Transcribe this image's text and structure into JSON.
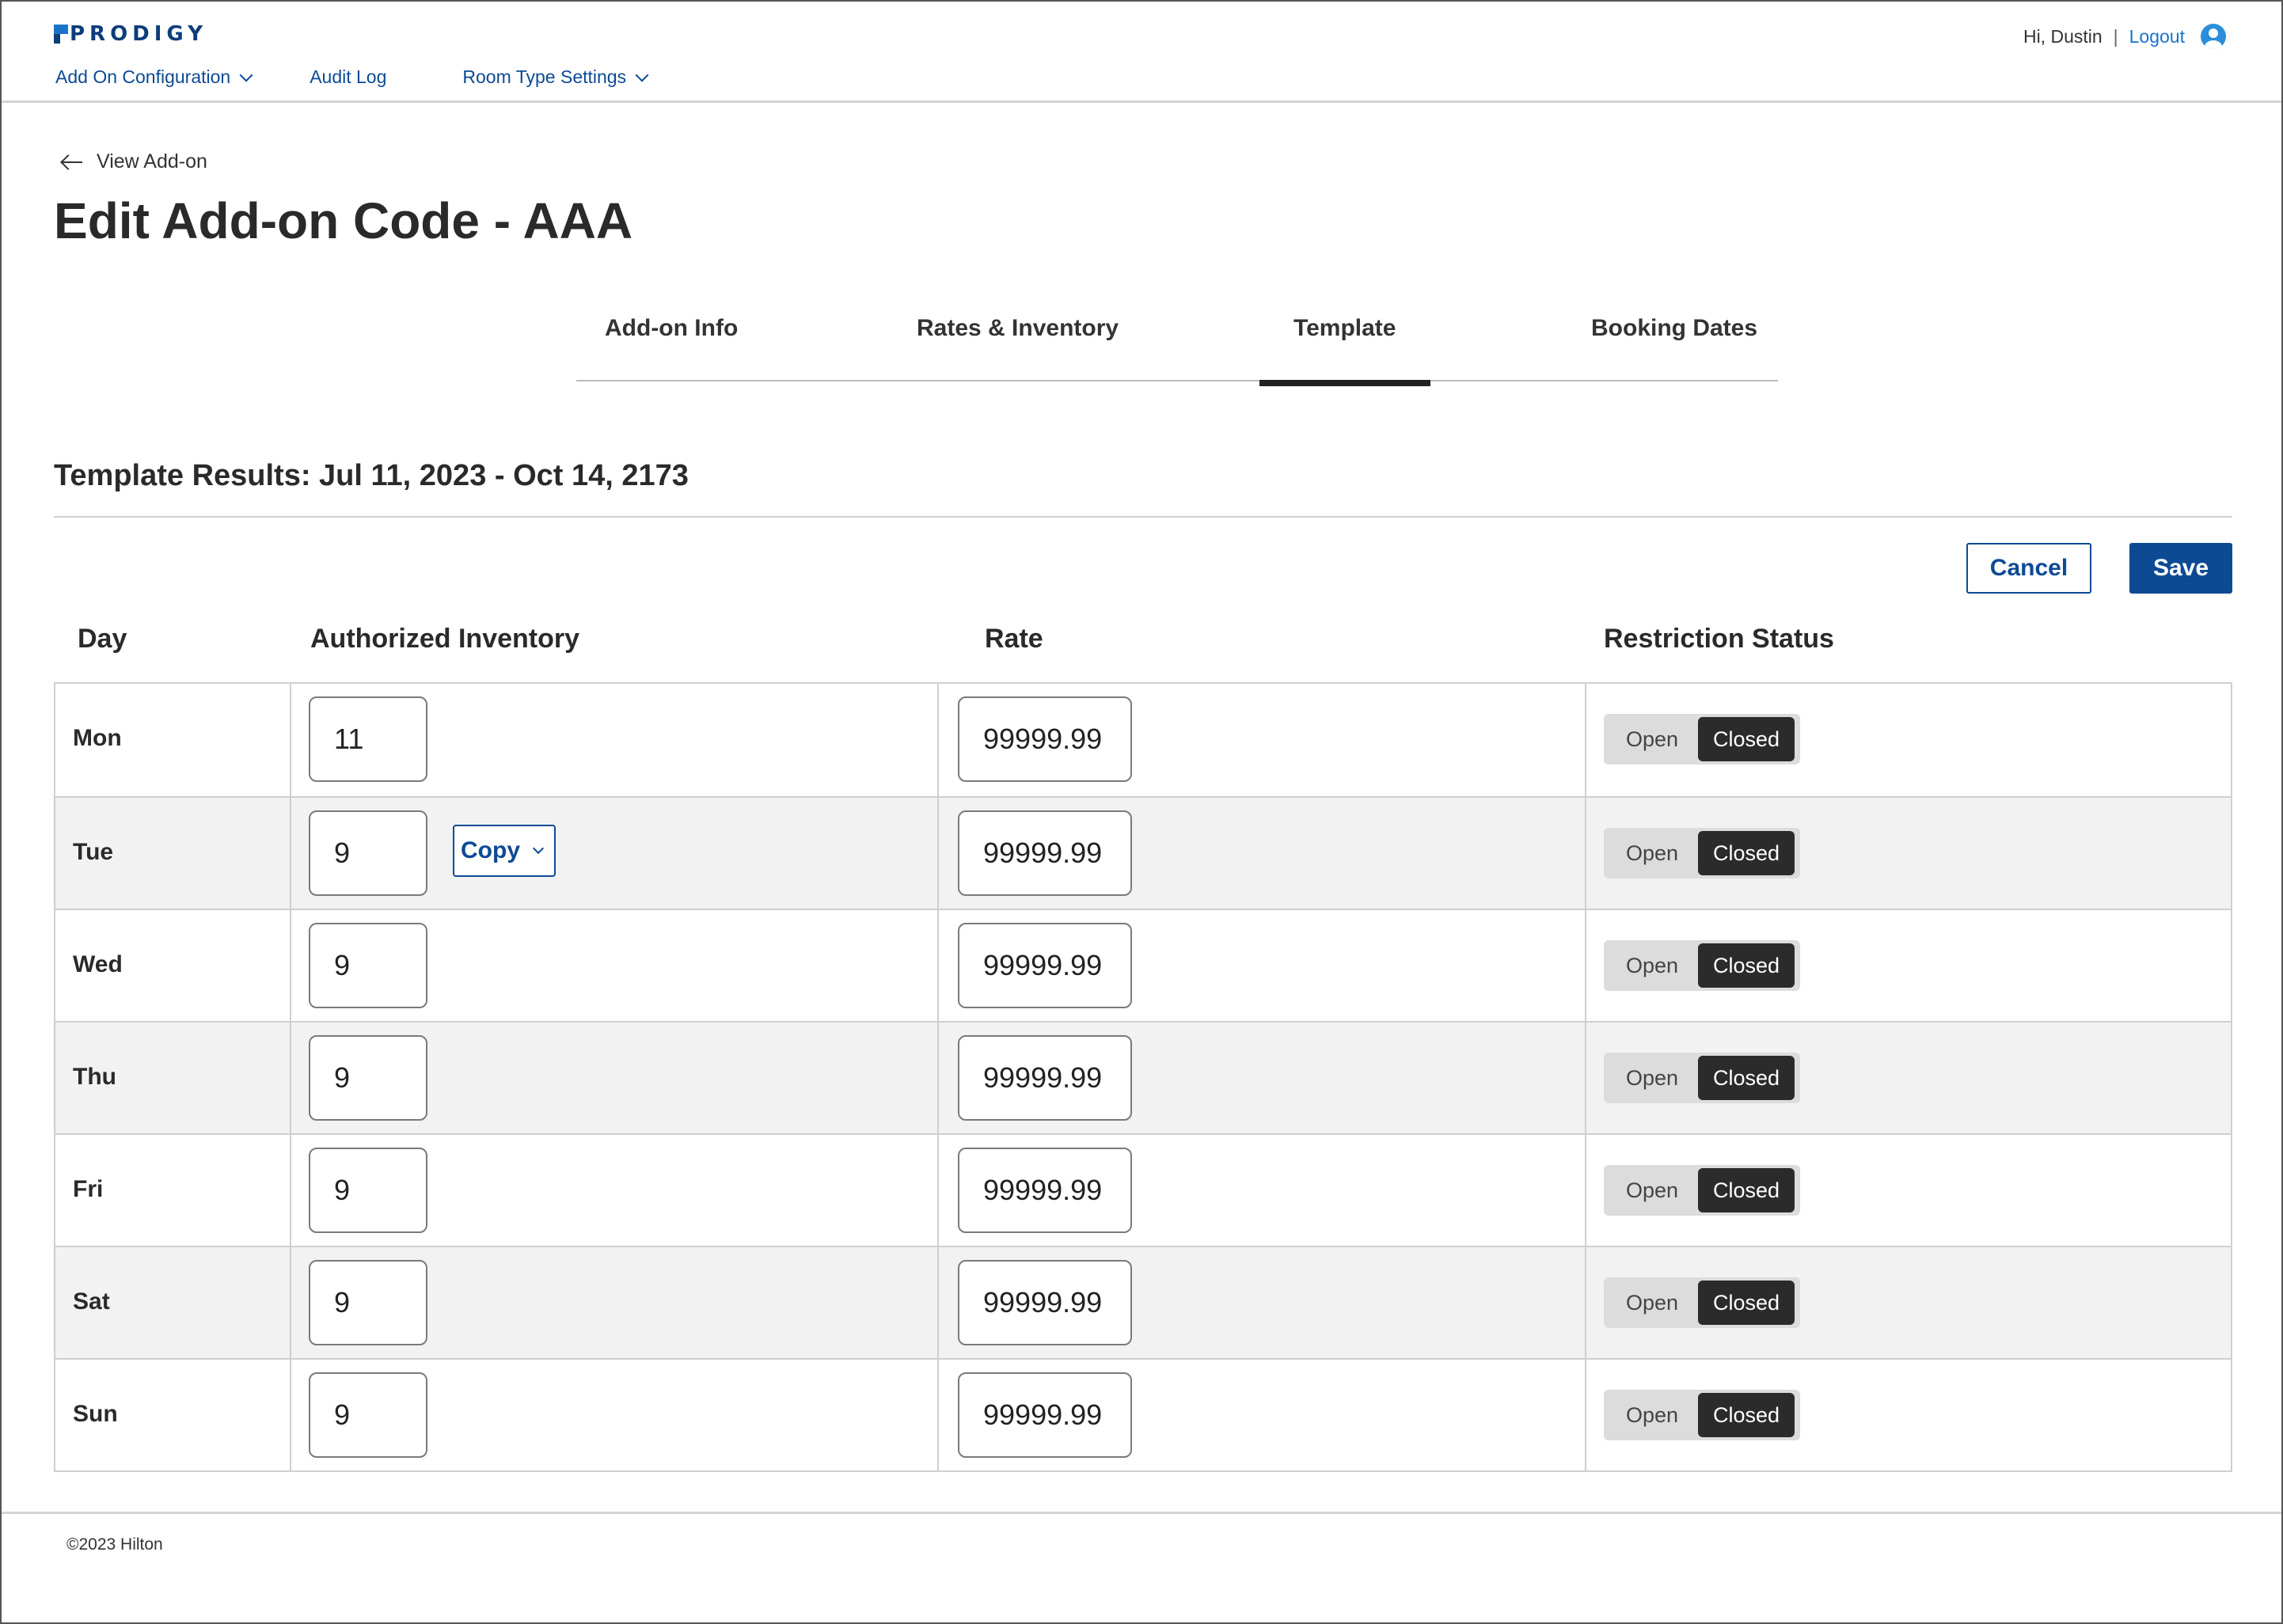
{
  "header": {
    "logo_text": "PRODIGY",
    "greeting": "Hi, Dustin",
    "separator": "|",
    "logout_label": "Logout",
    "nav": [
      {
        "label": "Add On Configuration",
        "has_dropdown": true
      },
      {
        "label": "Audit Log",
        "has_dropdown": false
      },
      {
        "label": "Room Type Settings",
        "has_dropdown": true
      }
    ]
  },
  "back_link": "View Add-on",
  "page_title": "Edit Add-on Code - AAA",
  "tabs": [
    {
      "label": "Add-on Info",
      "active": false
    },
    {
      "label": "Rates & Inventory",
      "active": false
    },
    {
      "label": "Template",
      "active": true
    },
    {
      "label": "Booking Dates",
      "active": false
    }
  ],
  "section_title": "Template Results: Jul 11, 2023 - Oct 14, 2173",
  "actions": {
    "cancel": "Cancel",
    "save": "Save"
  },
  "columns": [
    "Day",
    "Authorized Inventory",
    "Rate",
    "Restriction Status"
  ],
  "copy_label": "Copy",
  "toggle": {
    "open": "Open",
    "closed": "Closed"
  },
  "rows": [
    {
      "day": "Mon",
      "inventory": "11",
      "rate": "99999.99",
      "status": "Closed"
    },
    {
      "day": "Tue",
      "inventory": "9",
      "rate": "99999.99",
      "status": "Closed"
    },
    {
      "day": "Wed",
      "inventory": "9",
      "rate": "99999.99",
      "status": "Closed"
    },
    {
      "day": "Thu",
      "inventory": "9",
      "rate": "99999.99",
      "status": "Closed"
    },
    {
      "day": "Fri",
      "inventory": "9",
      "rate": "99999.99",
      "status": "Closed"
    },
    {
      "day": "Sat",
      "inventory": "9",
      "rate": "99999.99",
      "status": "Closed"
    },
    {
      "day": "Sun",
      "inventory": "9",
      "rate": "99999.99",
      "status": "Closed"
    }
  ],
  "footer": "©2023 Hilton",
  "colors": {
    "brand_blue": "#0d4a94",
    "link_blue": "#1a73c9",
    "toggle_active": "#2b2b2b"
  }
}
